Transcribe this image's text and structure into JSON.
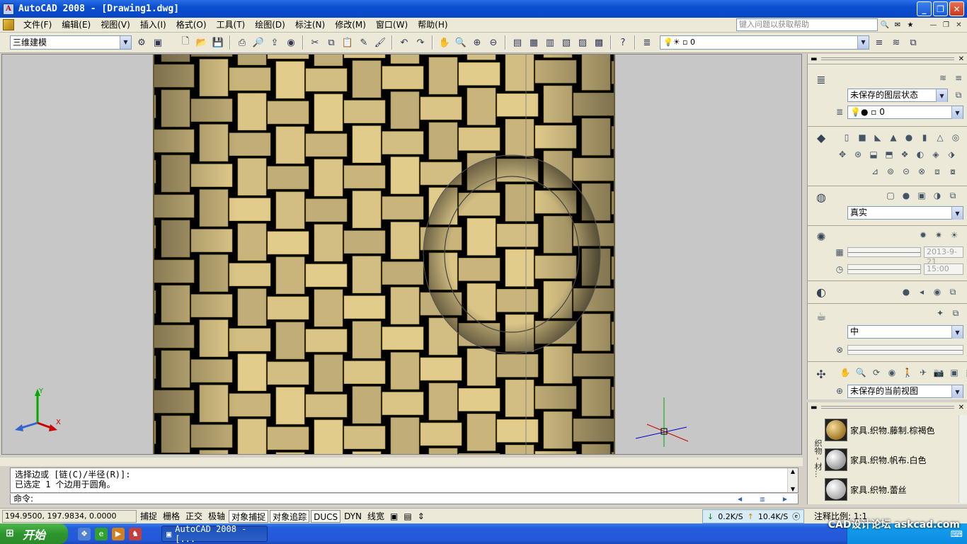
{
  "title": "AutoCAD 2008 - [Drawing1.dwg]",
  "app_icon_letter": "A",
  "window_controls": {
    "minimize": "_",
    "maximize": "❐",
    "close": "✕"
  },
  "menu": [
    "文件(F)",
    "编辑(E)",
    "视图(V)",
    "插入(I)",
    "格式(O)",
    "工具(T)",
    "绘图(D)",
    "标注(N)",
    "修改(M)",
    "窗口(W)",
    "帮助(H)"
  ],
  "help_search": {
    "placeholder": "键入问题以获取帮助"
  },
  "workspace": {
    "value": "三维建模"
  },
  "layer": {
    "value": "0"
  },
  "palette": {
    "layer_state": "未保存的图层状态",
    "layer_value": "0",
    "visual_style": "真实",
    "date_field": "2013-9-21",
    "time_field": "15:00",
    "material_quality": "中",
    "current_view": "未保存的当前视图"
  },
  "materials": {
    "side_label": "织物 - 材...",
    "items": [
      {
        "label": "家具.织物.藤制.棕褐色",
        "color": "#c8a048"
      },
      {
        "label": "家具.织物.帆布.白色",
        "color": "#e8e8e8"
      },
      {
        "label": "家具.织物.蕾丝",
        "color": "#f0f0f0"
      }
    ]
  },
  "command": {
    "line1": "选择边或 [链(C)/半径(R)]:",
    "line2": "已选定 1 个边用于圆角。",
    "prompt": "命令:"
  },
  "status": {
    "coords": "194.9500, 197.9834, 0.0000",
    "buttons": [
      {
        "label": "捕捉",
        "on": false
      },
      {
        "label": "栅格",
        "on": false
      },
      {
        "label": "正交",
        "on": false
      },
      {
        "label": "极轴",
        "on": false
      },
      {
        "label": "对象捕捉",
        "on": true
      },
      {
        "label": "对象追踪",
        "on": true
      },
      {
        "label": "DUCS",
        "on": true
      },
      {
        "label": "DYN",
        "on": false
      },
      {
        "label": "线宽",
        "on": false
      }
    ],
    "net_down": "0.2K/S",
    "net_up": "10.4K/S",
    "annotation_scale": "注释比例: 1:1"
  },
  "taskbar": {
    "start": "开始",
    "task": "AutoCAD 2008 - [..."
  },
  "watermark": "CAD设计论坛 askcad.com",
  "ucs": {
    "x": "X",
    "y": "Y"
  },
  "colors": {
    "title_bar": "#0a46c4",
    "viewport_bg": "#c7c7c7",
    "weave_light": "#e2cc8c",
    "weave_dark": "#000000"
  }
}
